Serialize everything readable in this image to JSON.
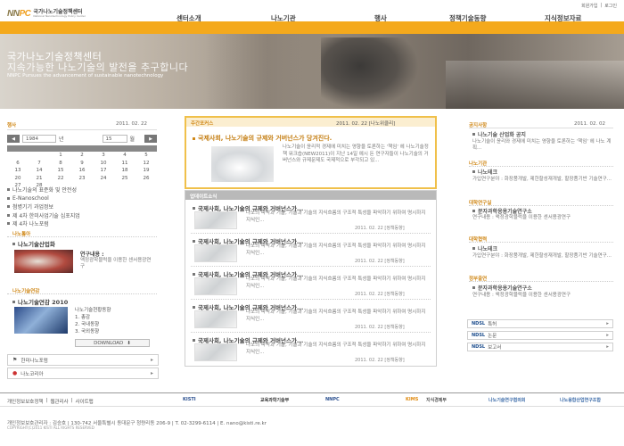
{
  "header": {
    "logo_mark_a": "NN",
    "logo_mark_b": "PC",
    "logo_kr": "국가나노기술정책센터",
    "logo_en": "National Nanotechnology Policy Center",
    "util_links": [
      "회원가입",
      "|",
      "로그인"
    ],
    "gnb": [
      "센터소개",
      "나노기관",
      "행사",
      "정책기술동향",
      "지식정보자료"
    ]
  },
  "hero": {
    "line1": "국가나노기술정책센터",
    "line2": "지속가능한 나노기술의 발전을 추구합니다",
    "line3": "NNPC Pursues the advancement of sustainable nanotechnology"
  },
  "left": {
    "event_title": "행사",
    "event_date": "2011. 02. 22",
    "cal_prev": "◀",
    "cal_next": "▶",
    "cal_year": "1984",
    "cal_year_label": "년",
    "cal_month": "15",
    "cal_month_label": "월",
    "cal_rows": [
      [
        "",
        "",
        "1",
        "2",
        "3",
        "4",
        "5"
      ],
      [
        "6",
        "7",
        "8",
        "9",
        "10",
        "11",
        "12"
      ],
      [
        "13",
        "14",
        "15",
        "16",
        "17",
        "18",
        "19"
      ],
      [
        "20",
        "21",
        "22",
        "23",
        "24",
        "25",
        "26"
      ],
      [
        "27",
        "28",
        "",
        "",
        "",
        "",
        ""
      ]
    ],
    "event_list": [
      "나노기술의 표준화 및 안전성",
      "E-Nanoschool",
      "첨병기기 과업정보",
      "제 4차 한미사업기술 심포지엄",
      "제 4차 나노포럼"
    ],
    "nanoinfra_head": "나노톺아",
    "nanoinfra_title": "나노기술산업화",
    "nanoinfra_sub": "연구내용 :",
    "nanoinfra_desc": "액정광학블럭을 이용한 센서용광연구",
    "yearbook_head": "나노기술연감",
    "yearbook_title": "나노기술연감 2010",
    "yearbook_item0": "나노기술현황동향",
    "yearbook_item1": "1. 총감",
    "yearbook_item2": "2. 국내동향",
    "yearbook_item3": "3. 국외동향",
    "download": "DOWNLOAD",
    "link1": "한미나노포럼",
    "link2": "나노코리아"
  },
  "center": {
    "focus_tag": "주간포커스",
    "focus_date": "2011. 02. 22 [나노위클리]",
    "focus_title": "국제사회, 나노기술의 규제와 거버넌스가 당겨진다.",
    "focus_summary": "나노기술이 윤리적 경제에 미치는 영향을 토론하는 '책임' 헤 나노기술정책 워크숍(NEW2011)이 지난 14일 예시 돈 연구자들이 나노기술의 거버넌스와 규제문제도 국제적으로 부각되고 있...",
    "update_tag": "업데이트소식",
    "news": [
      {
        "title": "국제사회, 나노기술의 규제와 거버넌스가...",
        "summary": "나노의 파악과 기술, 기술과 기술의 지식흐름의 구조적 특성을 파악하기 위하여 명시하지 지식인...",
        "date": "2011. 02. 22 [정책동향]"
      },
      {
        "title": "국제사회, 나노기술의 규제와 거버넌스가...",
        "summary": "나노의 파악과 기술, 기술과 기술의 지식흐름의 구조적 특성을 파악하기 위하여 명시하지 지식인...",
        "date": "2011. 02. 22 [정책동향]"
      },
      {
        "title": "국제사회, 나노기술의 규제와 거버넌스가...",
        "summary": "나노의 파악과 기술, 기술과 기술의 지식흐름의 구조적 특성을 파악하기 위하여 명시하지 지식인...",
        "date": "2011. 02. 22 [정책동향]"
      },
      {
        "title": "국제사회, 나노기술의 규제와 거버넌스가...",
        "summary": "나노의 파악과 기술, 기술과 기술의 지식흐름의 구조적 특성을 파악하기 위하여 명시하지 지식인...",
        "date": "2011. 02. 22 [정책동향]"
      },
      {
        "title": "국제사회, 나노기술의 규제와 거버넌스가...",
        "summary": "나노의 파악과 기술, 기술과 기술의 지식흐름의 구조적 특성을 파악하기 위하여 명시하지 지식인...",
        "date": "2011. 02. 22 [정책동향]"
      }
    ]
  },
  "right": {
    "notice_head": "공지사항",
    "notice_date": "2011. 02. 02",
    "notice_title": "나노기술 산업화 공지",
    "notice_summary": "나노기술이 윤리와 경제에 미치는 영향을 토론하는 '책임' 헤 나노 계획...",
    "tech_head": "나노기관",
    "tech_title": "나노테크",
    "tech_desc": "가입연구분야 : 화장품개발, 제한할성재개발, 할장품기반 기술연구...",
    "grad_head": "대학연구실",
    "grad_title": "분자과학응용기술연구소",
    "grad_desc": "연구내용 : 액정광학블럭을 이용한 센서용광연구",
    "company_head": "대학협력",
    "company_title": "나노테크",
    "company_desc": "가입연구분야 : 화장품개발, 제한할성재개발, 할장품기반 기술연구...",
    "invest_head": "정부출연",
    "invest_title": "분자과학응용기술연구소",
    "invest_desc": "연구내용 : 액정광학블럭을 이용한 센서용광연구",
    "nbtn_logo": "NDSL",
    "nbtn1": "특허",
    "nbtn2": "논문",
    "nbtn3": "보고서",
    "arrow": "▸"
  },
  "footer": {
    "links": [
      "개인정보보호정책",
      "|",
      "웹관리사",
      "|",
      "사이트맵"
    ],
    "logos": [
      "KISTI",
      "교육과학기술부",
      "NNPC",
      "KIMS",
      "지식경제부",
      "나노기술연구협의회",
      "나노융합산업연구조합"
    ],
    "address": "개인정보보호관리자 : 김승호 | 130-742 서울특별시 동대문구 청량리동 206-9 | T. 02-3299-6114 | E. nano@kisti.re.kr",
    "copyright": "COPYRIGHT(C)2011 KISTI ALL RIGHTS RESERVED"
  }
}
